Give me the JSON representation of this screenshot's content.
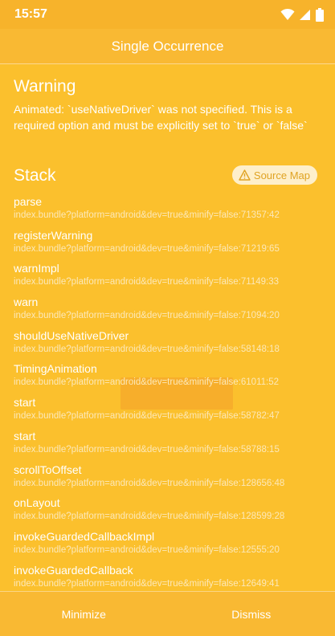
{
  "status_bar": {
    "time": "15:57",
    "icons": [
      "wifi-icon",
      "signal-icon",
      "battery-icon"
    ]
  },
  "header": {
    "title": "Single Occurrence"
  },
  "warning": {
    "heading": "Warning",
    "message": "Animated: `useNativeDriver` was not specified. This is a required option and must be explicitly set to `true` or `false`"
  },
  "stack": {
    "heading": "Stack",
    "source_map_label": "Source Map",
    "frames": [
      {
        "name": "parse",
        "location": "index.bundle?platform=android&dev=true&minify=false:71357:42"
      },
      {
        "name": "registerWarning",
        "location": "index.bundle?platform=android&dev=true&minify=false:71219:65"
      },
      {
        "name": "warnImpl",
        "location": "index.bundle?platform=android&dev=true&minify=false:71149:33"
      },
      {
        "name": "warn",
        "location": "index.bundle?platform=android&dev=true&minify=false:71094:20"
      },
      {
        "name": "shouldUseNativeDriver",
        "location": "index.bundle?platform=android&dev=true&minify=false:58148:18"
      },
      {
        "name": "TimingAnimation",
        "location": "index.bundle?platform=android&dev=true&minify=false:61011:52"
      },
      {
        "name": "start",
        "location": "index.bundle?platform=android&dev=true&minify=false:58782:47"
      },
      {
        "name": "start",
        "location": "index.bundle?platform=android&dev=true&minify=false:58788:15"
      },
      {
        "name": "scrollToOffset",
        "location": "index.bundle?platform=android&dev=true&minify=false:128656:48"
      },
      {
        "name": "onLayout",
        "location": "index.bundle?platform=android&dev=true&minify=false:128599:28"
      },
      {
        "name": "invokeGuardedCallbackImpl",
        "location": "index.bundle?platform=android&dev=true&minify=false:12555:20"
      },
      {
        "name": "invokeGuardedCallback",
        "location": "index.bundle?platform=android&dev=true&minify=false:12649:41"
      }
    ]
  },
  "footer": {
    "minimize_label": "Minimize",
    "dismiss_label": "Dismiss"
  },
  "colors": {
    "background": "#FBC02D",
    "source_map_text": "#E0A323"
  }
}
